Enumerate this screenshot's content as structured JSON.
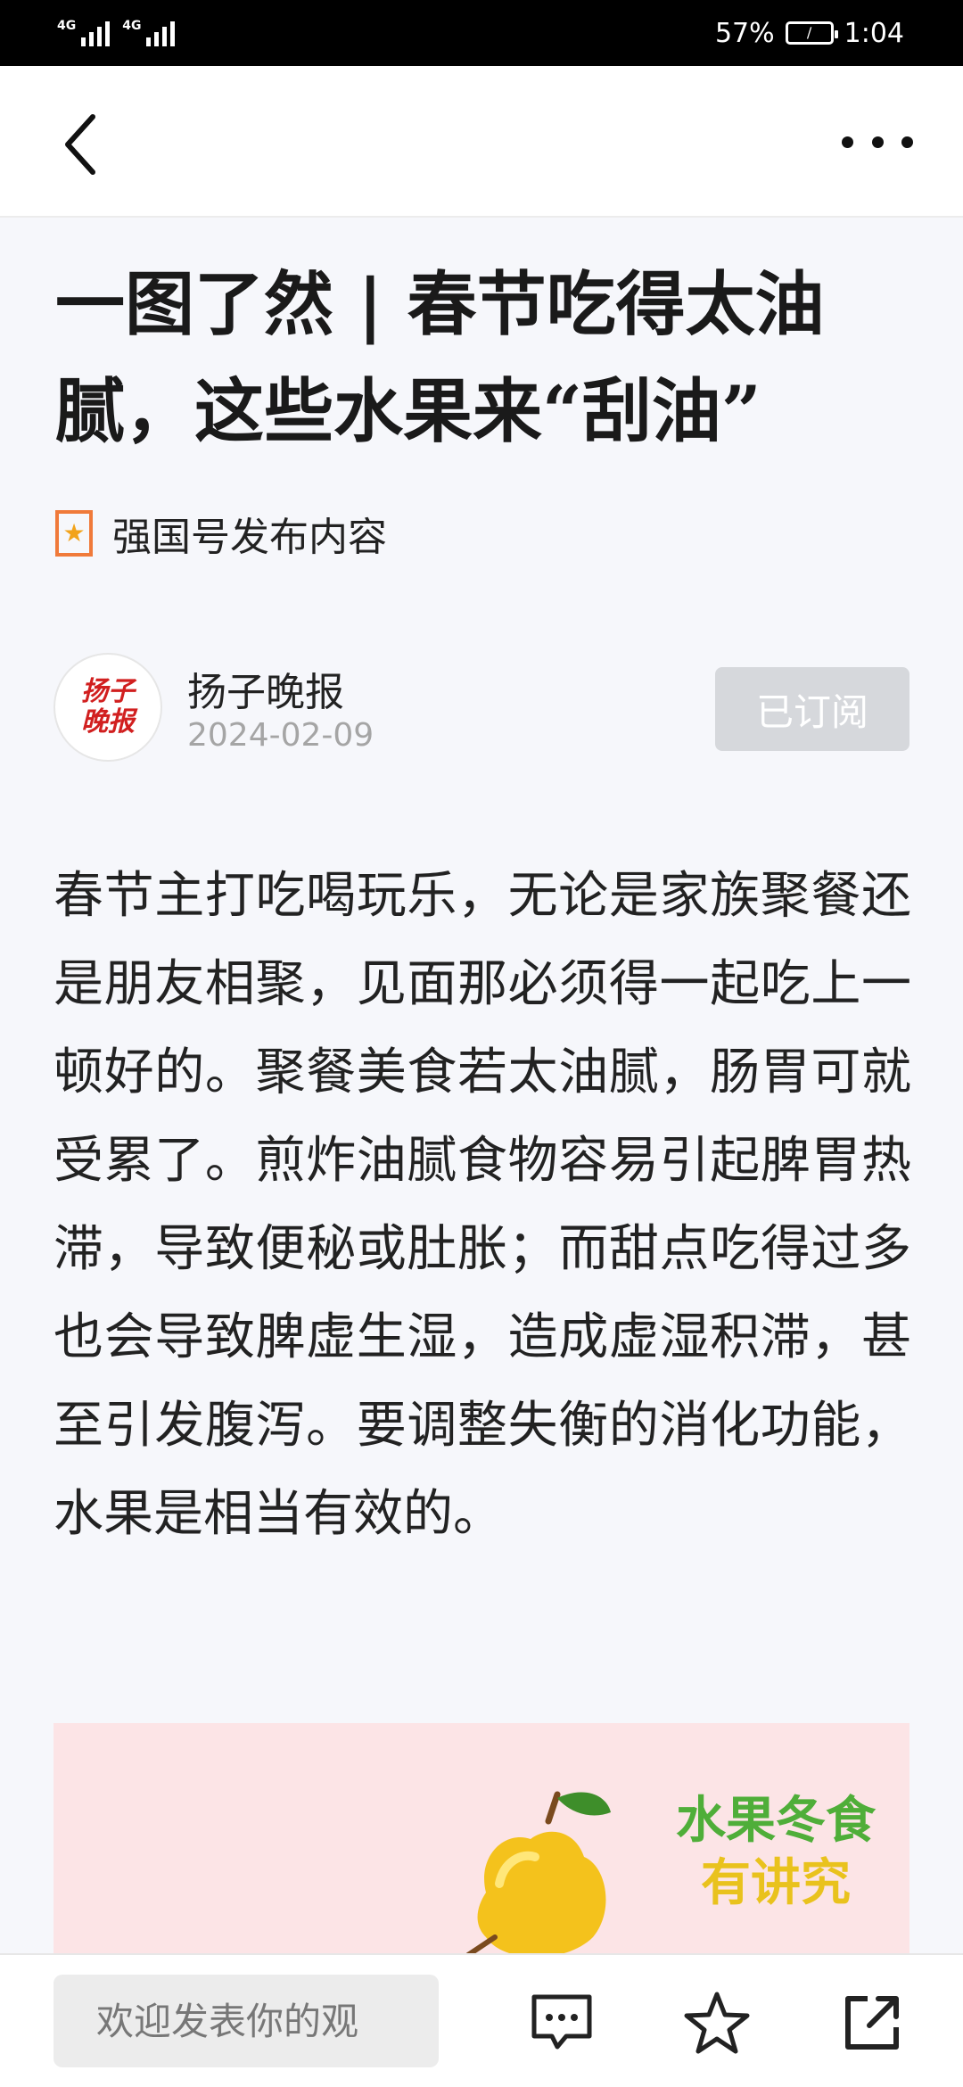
{
  "status_bar": {
    "signal_1": "4G",
    "signal_2": "4G",
    "battery_percent": "57%",
    "time": "1:04"
  },
  "nav": {
    "back_icon": "chevron-left-icon",
    "more_icon": "more-dots-icon"
  },
  "article": {
    "title": "一图了然 | 春节吃得太油腻，这些水果来“刮油”",
    "source_tag": "强国号发布内容",
    "author": {
      "name": "扬子晚报",
      "date": "2024-02-09",
      "avatar_text": "扬子晚报",
      "subscribe_label": "已订阅"
    },
    "body": "春节主打吃喝玩乐，无论是家族聚餐还是朋友相聚，见面那必须得一起吃上一顿好的。聚餐美食若太油腻，肠胃可就受累了。煎炸油腻食物容易引起脾胃热滞，导致便秘或肚胀；而甜点吃得过多也会导致脾虚生湿，造成虚湿积滞，甚至引发腹泻。要调整失衡的消化功能，水果是相当有效的。",
    "banner": {
      "line1": "水果冬食",
      "line2": "有讲究"
    }
  },
  "bottom_bar": {
    "comment_placeholder": "欢迎发表你的观",
    "icons": [
      "comment-icon",
      "star-icon",
      "share-icon"
    ]
  },
  "colors": {
    "subscribe_bg": "#d6d8dc",
    "source_icon": "#f07a3a",
    "banner_bg": "#fce4e6"
  }
}
